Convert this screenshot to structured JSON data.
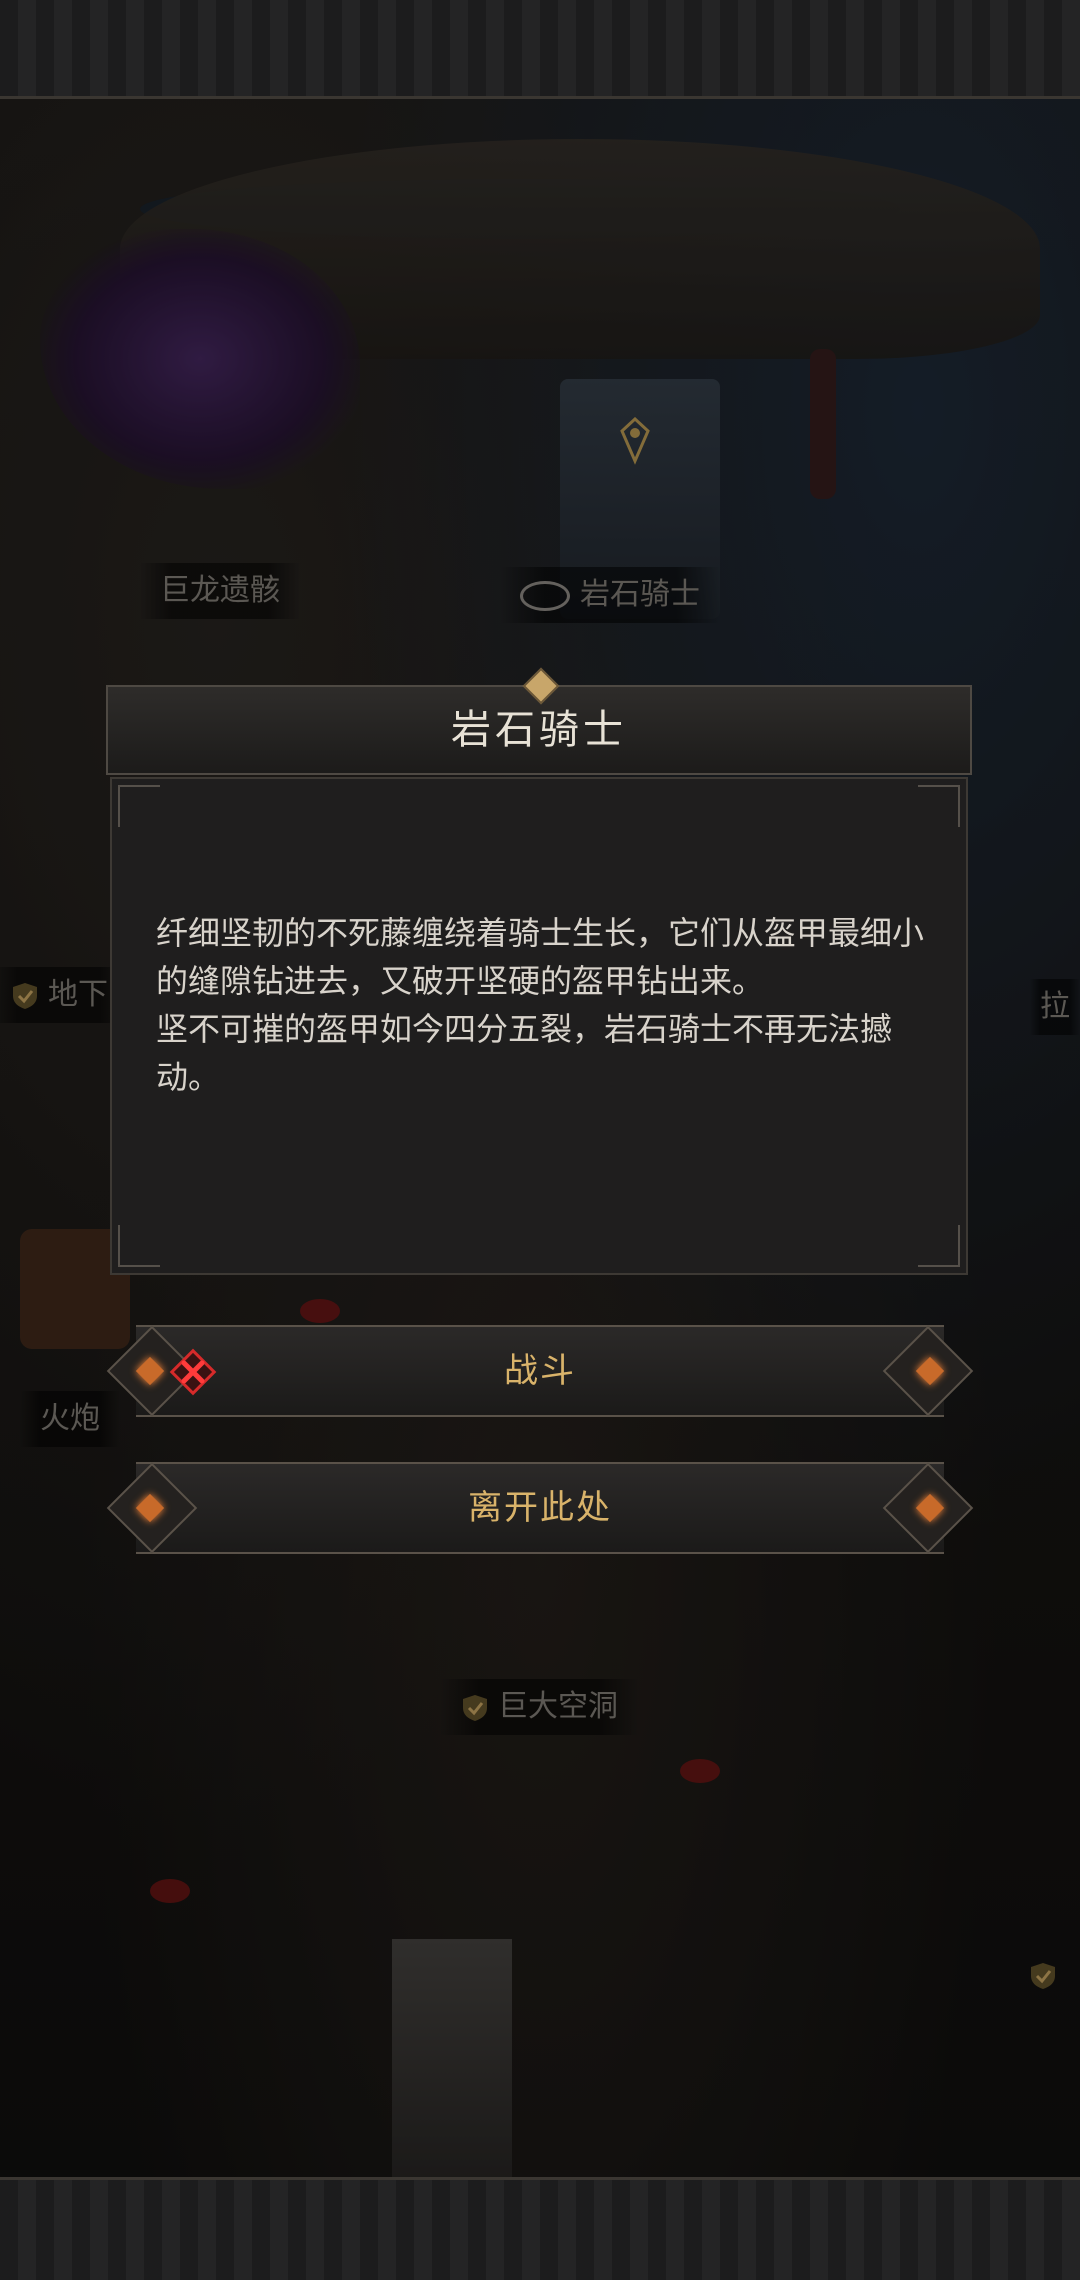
{
  "map": {
    "labels": {
      "dragon_remains": "巨龙遗骸",
      "rock_knight": "岩石骑士",
      "underground": "地下",
      "cannon": "火炮",
      "giant_cave": "巨大空洞",
      "right_edge": "拉"
    }
  },
  "dialog": {
    "title": "岩石骑士",
    "description_line1": "纤细坚韧的不死藤缠绕着骑士生长，它们从盔甲最细小的缝隙钻进去，又破开坚硬的盔甲钻出来。",
    "description_line2": "坚不可摧的盔甲如今四分五裂，岩石骑士不再无法撼动。"
  },
  "actions": {
    "fight": "战斗",
    "leave": "离开此处"
  },
  "colors": {
    "gold_text": "#d9b36a",
    "danger_red": "#d62a2a",
    "gem_orange": "#c86a2a"
  }
}
